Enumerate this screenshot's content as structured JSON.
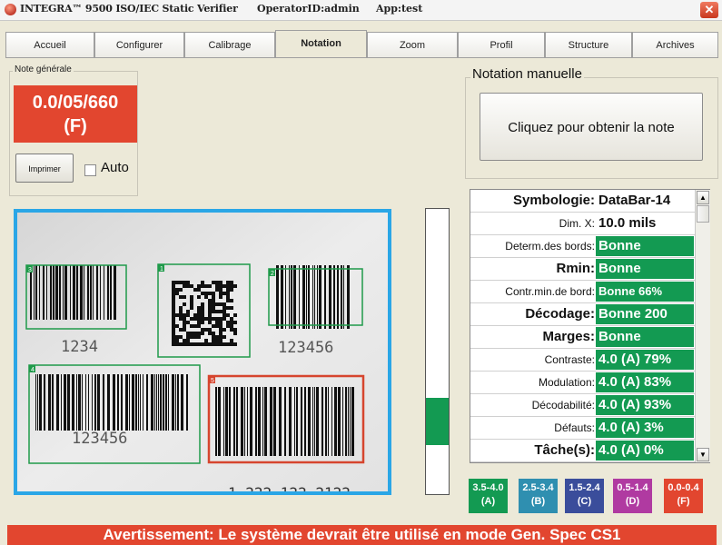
{
  "window": {
    "title": "INTEGRA™ 9500 ISO/IEC Static Verifier",
    "operator": "OperatorID:admin",
    "app": "App:test",
    "close_glyph": "✕"
  },
  "tabs": [
    "Accueil",
    "Configurer",
    "Calibrage",
    "Notation",
    "Zoom",
    "Profil",
    "Structure",
    "Archives"
  ],
  "active_tab": "Notation",
  "overall_grade": {
    "legend": "Note générale",
    "line1": "0.0/05/660",
    "line2": "(F)",
    "color": "#e2462f",
    "print_label": "Imprimer",
    "auto_label": "Auto",
    "auto_checked": false
  },
  "manual_grading": {
    "legend": "Notation manuelle",
    "button_label": "Cliquez pour obtenir la note"
  },
  "image_view": {
    "border_color": "#2aa6e6",
    "symbols": [
      {
        "number": "3",
        "text": "1234",
        "box_color": "#1f9a4a"
      },
      {
        "number": "1",
        "text": "",
        "box_color": "#1f9a4a"
      },
      {
        "number": "2",
        "text": "123456",
        "box_color": "#1f9a4a"
      },
      {
        "number": "4",
        "text": "123456",
        "box_color": "#1f9a4a"
      },
      {
        "number": "5",
        "text": "",
        "box_color": "#d6452e"
      }
    ],
    "bottom_text": "1 222 122 2122"
  },
  "meter": {
    "level": 0.2,
    "color": "#139a52"
  },
  "parameters": [
    {
      "label": "Symbologie:",
      "value": "DataBar-14",
      "label_bold": true,
      "value_style": "white"
    },
    {
      "label": "Dim. X:",
      "value": "10.0 mils",
      "label_bold": false,
      "value_style": "white"
    },
    {
      "label": "Determ.des bords:",
      "value": "Bonne",
      "label_bold": false,
      "value_style": "green"
    },
    {
      "label": "Rmin:",
      "value": "Bonne",
      "label_bold": true,
      "value_style": "green"
    },
    {
      "label": "Contr.min.de bord:",
      "value": "Bonne 66%",
      "label_bold": false,
      "value_style": "green-small"
    },
    {
      "label": "Décodage:",
      "value": "Bonne 200",
      "label_bold": true,
      "value_style": "green"
    },
    {
      "label": "Marges:",
      "value": "Bonne",
      "label_bold": true,
      "value_style": "green"
    },
    {
      "label": "Contraste:",
      "value": "4.0 (A) 79%",
      "label_bold": false,
      "value_style": "green"
    },
    {
      "label": "Modulation:",
      "value": "4.0 (A) 83%",
      "label_bold": false,
      "value_style": "green"
    },
    {
      "label": "Décodabilité:",
      "value": "4.0 (A) 93%",
      "label_bold": false,
      "value_style": "green"
    },
    {
      "label": "Défauts:",
      "value": "4.0 (A) 3%",
      "label_bold": false,
      "value_style": "green"
    },
    {
      "label": "Tâche(s):",
      "value": "4.0 (A) 0%",
      "label_bold": true,
      "value_style": "green"
    }
  ],
  "grade_legend": [
    {
      "range": "3.5-4.0",
      "grade": "(A)",
      "color": "#139a52"
    },
    {
      "range": "2.5-3.4",
      "grade": "(B)",
      "color": "#2f8fb0"
    },
    {
      "range": "1.5-2.4",
      "grade": "(C)",
      "color": "#3a4d9b"
    },
    {
      "range": "0.5-1.4",
      "grade": "(D)",
      "color": "#b03aa1"
    },
    {
      "range": "0.0-0.4",
      "grade": "(F)",
      "color": "#e2462f"
    }
  ],
  "warning": {
    "text": "Avertissement: Le système devrait être utilisé en mode Gen. Spec CS1"
  },
  "icons": {
    "app": "integra-logo-icon",
    "close": "close-icon",
    "scroll_up": "scroll-up-icon",
    "scroll_down": "scroll-down-icon"
  }
}
